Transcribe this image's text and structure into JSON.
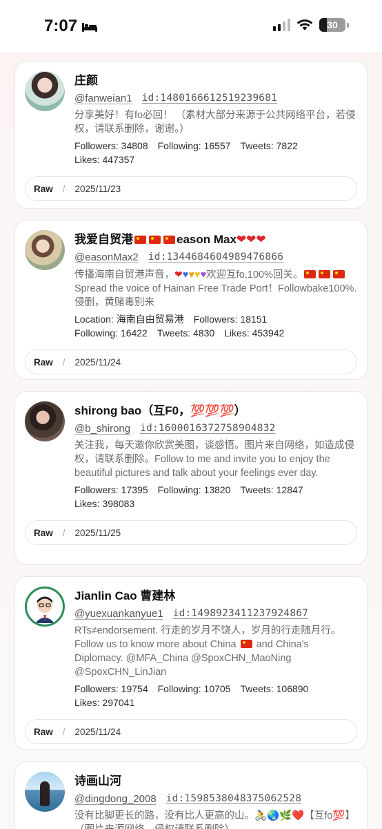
{
  "status": {
    "time": "7:07",
    "battery": "30"
  },
  "cards": [
    {
      "name": "庄颜",
      "handle": "@fanweian1",
      "id": "id:1480166612519239681",
      "bio": "分享美好！有fo必回！ （素材大部分来源于公共网络平台，若侵权，请联系删除，谢谢。）",
      "stats": [
        "Followers: 34808",
        "Following: 16557",
        "Tweets: 7822",
        "Likes: 447357"
      ],
      "raw": "Raw",
      "date": "2025/11/23"
    },
    {
      "name": "我爱自贸港🇨🇳🇨🇳🇨🇳eason Max❤️❤️❤️",
      "handle": "@easonMax2",
      "id": "id:1344684604989476866",
      "bio": "传播海南自贸港声音，❤️💙🧡💛💜欢迎互fo,100%回关。🇨🇳🇨🇳🇨🇳Spread the voice of Hainan Free Trade Port！Followbake100%.侵删，黄赌毒别来",
      "stats": [
        "Location: 海南自由贸易港",
        "Followers: 18151",
        "Following: 16422",
        "Tweets: 4830",
        "Likes: 453942"
      ],
      "raw": "Raw",
      "date": "2025/11/24"
    },
    {
      "name": "shirong bao（互F0，💯💯💯）",
      "handle": "@b_shirong",
      "id": "id:1600016372758904832",
      "bio": "关注我，每天邀你欣赏美图，谈感悟。图片来自网络，如造成侵权，请联系删除。Follow to me and invite you to enjoy the beautiful pictures and talk about your feelings ever day.",
      "stats": [
        "Followers: 17395",
        "Following: 13820",
        "Tweets: 12847",
        "Likes: 398083"
      ],
      "raw": "Raw",
      "date": "2025/11/25"
    },
    {
      "name": "Jianlin Cao 曹建林",
      "handle": "@yuexuankanyue1",
      "id": "id:1498923411237924867",
      "bio": "RTs≠endorsement. 行走的岁月不饶人，岁月的行走随月行。 Follow us to know more about China 🇨🇳 and China's Diplomacy. @MFA_China @SpoxCHN_MaoNing @SpoxCHN_LinJian",
      "stats": [
        "Followers: 19754",
        "Following: 10705",
        "Tweets: 106890",
        "Likes: 297041"
      ],
      "raw": "Raw",
      "date": "2025/11/24"
    },
    {
      "name": "诗画山河",
      "handle": "@dingdong_2008",
      "id": "id:1598538048375062528",
      "bio": "没有比脚更长的路，没有比人更高的山。🚴🌏🌿❤️【互fo💯】（图片来源网络，侵权请联系删除）",
      "stats": [],
      "raw": "",
      "date": ""
    }
  ]
}
